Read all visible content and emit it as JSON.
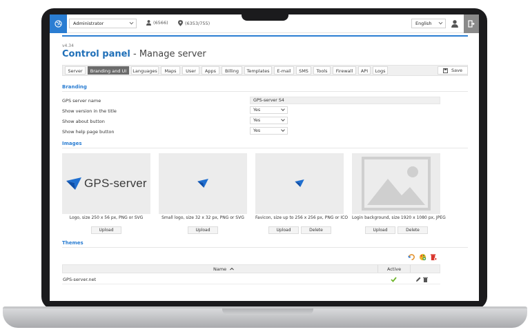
{
  "topbar": {
    "user_select": "Administrator",
    "users_count": "(6566)",
    "objects_count": "(6353/755)",
    "language_select": "English"
  },
  "header": {
    "version": "v4.34",
    "title_strong": "Control panel",
    "title_rest": " - Manage server"
  },
  "tabs": [
    {
      "label": "Server"
    },
    {
      "label": "Branding and UI",
      "active": true
    },
    {
      "label": "Languages"
    },
    {
      "label": "Maps"
    },
    {
      "label": "User"
    },
    {
      "label": "Apps"
    },
    {
      "label": "Billing"
    },
    {
      "label": "Templates"
    },
    {
      "label": "E-mail"
    },
    {
      "label": "SMS"
    },
    {
      "label": "Tools"
    },
    {
      "label": "Firewall"
    },
    {
      "label": "API"
    },
    {
      "label": "Logs"
    }
  ],
  "save_label": "Save",
  "branding": {
    "heading": "Branding",
    "server_name_label": "GPS server name",
    "server_name_value": "GPS-server S4",
    "show_version_label": "Show version in the title",
    "show_version_value": "Yes",
    "show_about_label": "Show about button",
    "show_about_value": "Yes",
    "show_help_label": "Show help page button",
    "show_help_value": "Yes"
  },
  "images": {
    "heading": "Images",
    "logo_text": "GPS-server",
    "items": [
      {
        "caption": "Logo, size 250 x 56 px, PNG or SVG",
        "upload": "Upload"
      },
      {
        "caption": "Small logo, size 32 x 32 px, PNG or SVG",
        "upload": "Upload"
      },
      {
        "caption": "Favicon, size up to 256 x 256 px, PNG or ICO",
        "upload": "Upload",
        "delete": "Delete"
      },
      {
        "caption": "Login background, size 1920 x 1080 px, JPEG",
        "upload": "Upload",
        "delete": "Delete"
      }
    ]
  },
  "themes": {
    "heading": "Themes",
    "col_name": "Name",
    "col_active": "Active",
    "rows": [
      {
        "name": "GPS-server.net",
        "active": true
      }
    ]
  },
  "colors": {
    "accent": "#2a7dd2",
    "active_tab": "#6b6b6b",
    "check": "#6fb52c"
  }
}
